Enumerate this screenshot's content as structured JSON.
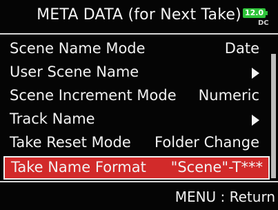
{
  "header": {
    "title": "META DATA (for Next Take)",
    "battery": {
      "voltage": "12.0",
      "source": "DC",
      "color": "#2fc43a"
    }
  },
  "menu": {
    "items": [
      {
        "label": "Scene Name Mode",
        "value": "Date"
      },
      {
        "label": "User Scene Name",
        "value": "",
        "icon": "arrow-right-icon"
      },
      {
        "label": "Scene Increment Mode",
        "value": "Numeric"
      },
      {
        "label": "Track Name",
        "value": "",
        "icon": "arrow-right-icon"
      },
      {
        "label": "Take Reset Mode",
        "value": "Folder Change"
      },
      {
        "label": "Take Name Format",
        "value": "\"Scene\"-T***",
        "selected": true
      }
    ],
    "selection_color": "#d22a2a"
  },
  "footer": {
    "hint": "MENU : Return"
  }
}
